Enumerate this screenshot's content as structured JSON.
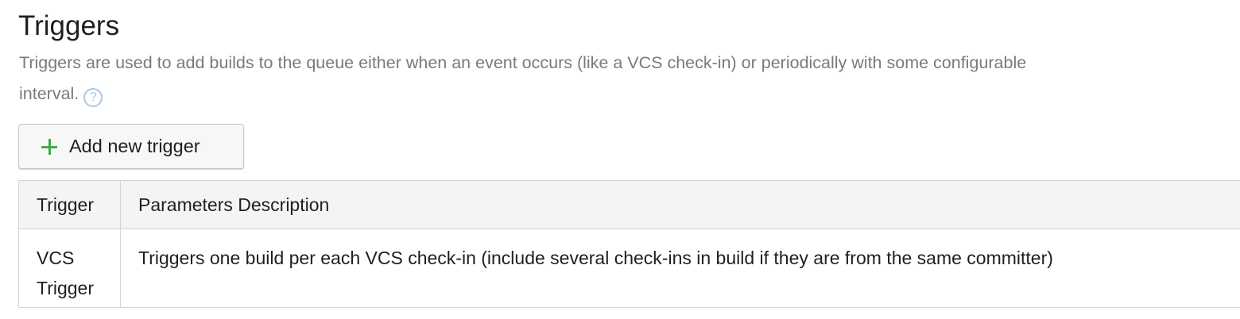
{
  "section": {
    "title": "Triggers",
    "description": "Triggers are used to add builds to the queue either when an event occurs (like a VCS check-in) or periodically with some configurable interval.",
    "help_icon": "?"
  },
  "toolbar": {
    "add_label": "Add new trigger",
    "add_icon": "plus-icon",
    "add_icon_color": "#3daa4b"
  },
  "table": {
    "headers": [
      "Trigger",
      "Parameters Description"
    ],
    "rows": [
      {
        "trigger": "VCS Trigger",
        "description": "Triggers one build per each VCS check-in (include several check-ins in build if they are from the same committer)"
      }
    ]
  }
}
